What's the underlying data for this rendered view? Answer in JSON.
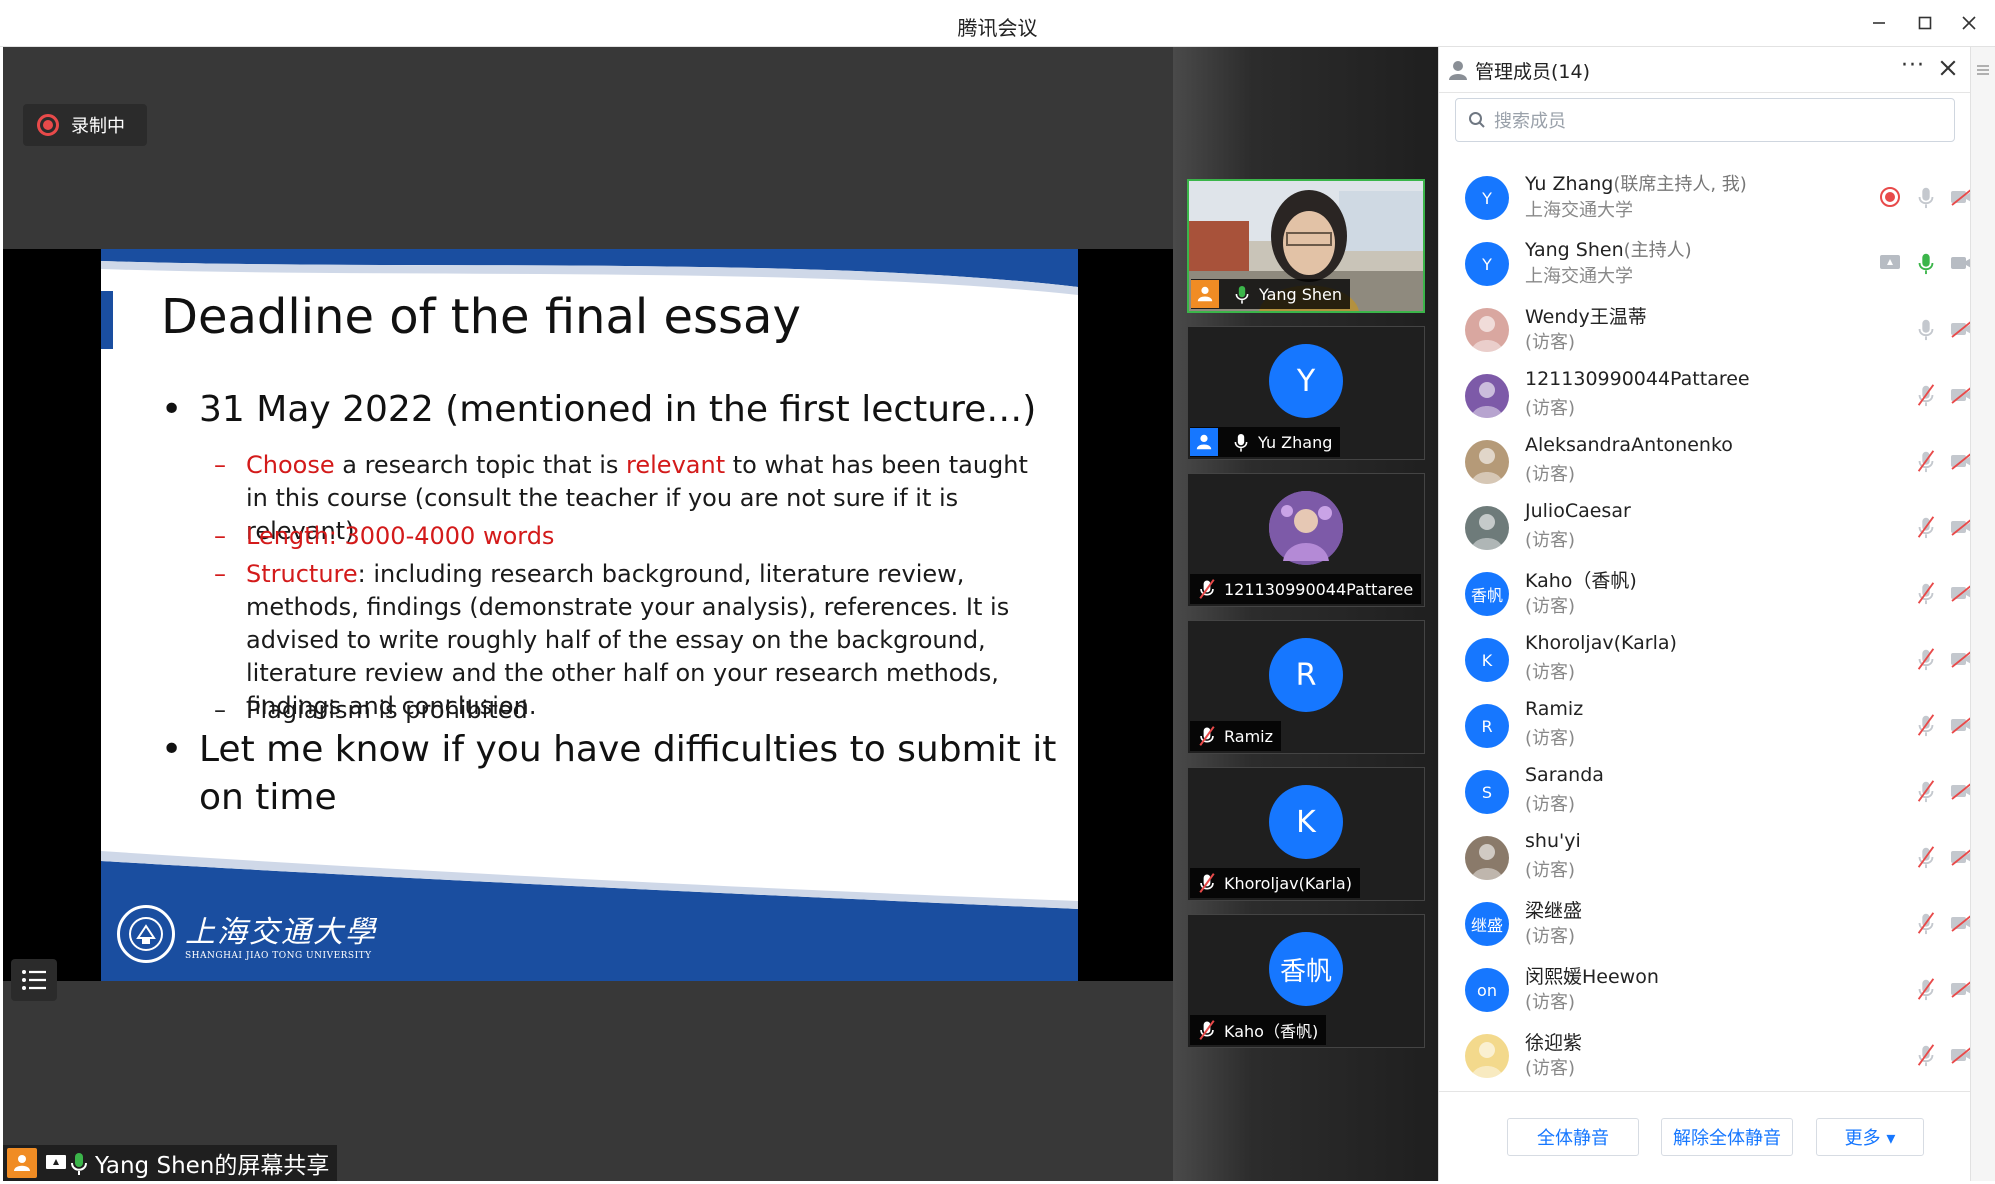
{
  "window": {
    "title": "腾讯会议"
  },
  "recording": {
    "label": "录制中"
  },
  "slide": {
    "title": "Deadline of the final essay",
    "bullet1": "31 May 2022 (mentioned in the first lecture…)",
    "sub1_a": "Choose",
    "sub1_b": " a research topic that is ",
    "sub1_c": "relevant",
    "sub1_d": " to what has been taught in this course (consult the teacher if you are not sure if it is relevant)",
    "sub2": "Length: 3000-4000 words",
    "sub3_a": "Structure",
    "sub3_b": ": including research background, literature review, methods, findings (demonstrate your analysis), references. It is advised to write roughly half of the essay on the background, literature review and the other half on your research methods, findings and conclusion.",
    "sub4": "Plagiarism is prohibited",
    "bullet2_line1": "Let me know if you have difficulties to submit it",
    "bullet2_line2": "on time",
    "logo_cn": "上海交通大學",
    "logo_en": "SHANGHAI JIAO TONG UNIVERSITY"
  },
  "share_bar": {
    "label": "Yang Shen的屏幕共享"
  },
  "thumbnails": [
    {
      "name": "Yang Shen"
    },
    {
      "initial": "Y",
      "name": "Yu Zhang"
    },
    {
      "name": "121130990044Pattaree"
    },
    {
      "initial": "R",
      "name": "Ramiz"
    },
    {
      "initial": "K",
      "name": "Khoroljav(Karla)"
    },
    {
      "initial": "香帆",
      "name": "Kaho（香帆)"
    }
  ],
  "panel": {
    "title": "管理成员(14)",
    "search_placeholder": "搜索成员",
    "members": [
      {
        "initial": "Y",
        "name": "Yu Zhang",
        "role": "(联席主持人, 我)",
        "sub": "上海交通大学"
      },
      {
        "initial": "Y",
        "name": "Yang Shen",
        "role": "(主持人)",
        "sub": "上海交通大学"
      },
      {
        "initial": "",
        "name": "Wendy王温蒂",
        "role": "",
        "sub": "(访客)"
      },
      {
        "initial": "",
        "name": "121130990044Pattaree",
        "role": "",
        "sub": "(访客)"
      },
      {
        "initial": "",
        "name": "AleksandraAntonenko",
        "role": "",
        "sub": "(访客)"
      },
      {
        "initial": "",
        "name": "JulioCaesar",
        "role": "",
        "sub": "(访客)"
      },
      {
        "initial": "香帆",
        "name": "Kaho（香帆)",
        "role": "",
        "sub": "(访客)"
      },
      {
        "initial": "K",
        "name": "Khoroljav(Karla)",
        "role": "",
        "sub": "(访客)"
      },
      {
        "initial": "R",
        "name": "Ramiz",
        "role": "",
        "sub": "(访客)"
      },
      {
        "initial": "S",
        "name": "Saranda",
        "role": "",
        "sub": "(访客)"
      },
      {
        "initial": "",
        "name": "shu'yi",
        "role": "",
        "sub": "(访客)"
      },
      {
        "initial": "继盛",
        "name": "梁继盛",
        "role": "",
        "sub": "(访客)"
      },
      {
        "initial": "on",
        "name": "闵熙媛Heewon",
        "role": "",
        "sub": "(访客)"
      },
      {
        "initial": "",
        "name": "徐迎紫",
        "role": "",
        "sub": "(访客)"
      }
    ],
    "buttons": {
      "mute_all": "全体静音",
      "unmute_all": "解除全体静音",
      "more": "更多 ▾"
    }
  },
  "colors": {
    "accent": "#1677ff",
    "recording": "#e84a4a",
    "slide_red": "#d31a1a",
    "slide_blue": "#1a4ea0",
    "active_border": "#3bb54a"
  }
}
